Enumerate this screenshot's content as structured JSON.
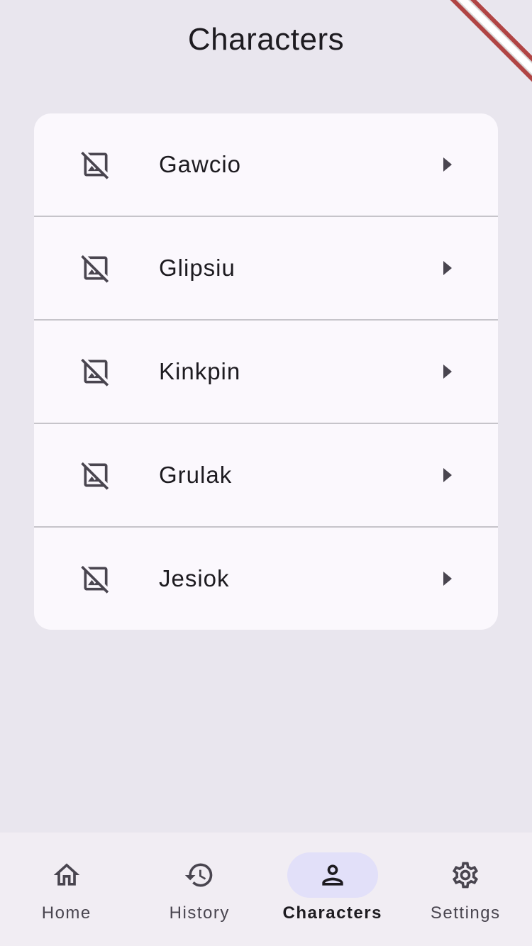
{
  "header": {
    "title": "Characters"
  },
  "characters": [
    {
      "name": "Gawcio",
      "icon": "hide-image-icon"
    },
    {
      "name": "Glipsiu",
      "icon": "hide-image-icon"
    },
    {
      "name": "Kinkpin",
      "icon": "hide-image-icon"
    },
    {
      "name": "Grulak",
      "icon": "hide-image-icon"
    },
    {
      "name": "Jesiok",
      "icon": "hide-image-icon"
    }
  ],
  "nav": {
    "items": [
      {
        "label": "Home",
        "icon": "home-icon",
        "active": false
      },
      {
        "label": "History",
        "icon": "history-icon",
        "active": false
      },
      {
        "label": "Characters",
        "icon": "person-icon",
        "active": true
      },
      {
        "label": "Settings",
        "icon": "gear-icon",
        "active": false
      }
    ]
  },
  "colors": {
    "background": "#e9e6ee",
    "card": "#fbf8fd",
    "nav_background": "#f1edf3",
    "active_indicator": "#e2e0f9",
    "text": "#1d1b20",
    "icon": "#49454f",
    "debug_banner": "#b04444"
  }
}
